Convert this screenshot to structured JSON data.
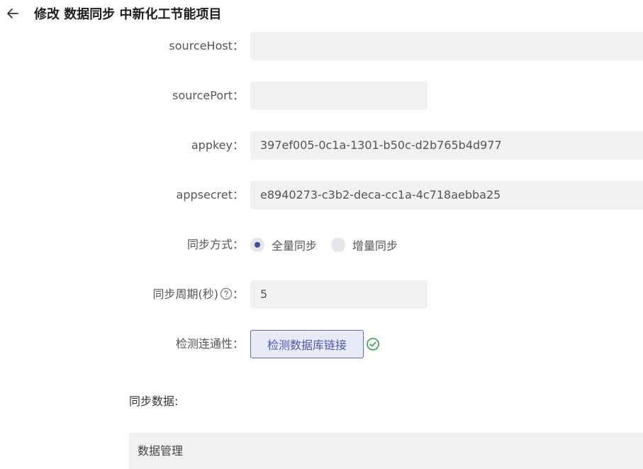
{
  "header": {
    "title": "修改 数据同步 中新化工节能项目"
  },
  "form": {
    "source_host": {
      "label": "sourceHost",
      "value": ""
    },
    "source_port": {
      "label": "sourcePort",
      "value": ""
    },
    "appkey": {
      "label": "appkey",
      "value": "397ef005-0c1a-1301-b50c-d2b765b4d977"
    },
    "appsecret": {
      "label": "appsecret",
      "value": "e8940273-c3b2-deca-cc1a-4c718aebba25"
    },
    "sync_mode": {
      "label": "同步方式",
      "options": [
        "全量同步",
        "增量同步"
      ],
      "selected": "全量同步"
    },
    "sync_period": {
      "label": "同步周期(秒)",
      "value": "5"
    },
    "connectivity": {
      "label": "检测连通性",
      "button_label": "检测数据库链接",
      "status": "success"
    },
    "colon": "："
  },
  "sync_data": {
    "title": "同步数据:",
    "panel_title": "数据管理"
  },
  "colors": {
    "accent": "#3d4fa8",
    "success": "#2ea043",
    "input_bg": "#f0f1f3"
  }
}
